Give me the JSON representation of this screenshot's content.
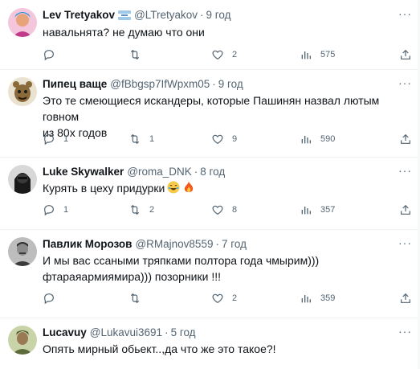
{
  "tweets": [
    {
      "name": "Lev Tretyakov",
      "handle": "@LTretyakov",
      "time": "9 год",
      "lines": [
        "навальнята? не думаю что они"
      ],
      "replies": "",
      "retweets": "",
      "likes": "2",
      "views": "575",
      "avatar_color": "#c23a8a"
    },
    {
      "name": "Пипец ваще",
      "handle": "@fBbgsp7IfWpxm05",
      "time": "9 год",
      "lines": [
        "Это те смеющиеся искандеры, которые Пашинян назвал лютым говном",
        "из 80х годов"
      ],
      "replies": "1",
      "retweets": "1",
      "likes": "9",
      "views": "590",
      "avatar_color": "#8a6a3a"
    },
    {
      "name": "Luke Skywalker",
      "handle": "@roma_DNK",
      "time": "8 год",
      "lines": [
        "Курять в цеху придурки"
      ],
      "replies": "1",
      "retweets": "2",
      "likes": "8",
      "views": "357",
      "avatar_color": "#2b2b2b"
    },
    {
      "name": "Павлик Морозов",
      "handle": "@RMajnov8559",
      "time": "7 год",
      "lines": [
        "И мы вас ссаными тряпками полтора года чмырим)))",
        "фтараяармиямира))) позорники !!!"
      ],
      "replies": "",
      "retweets": "",
      "likes": "2",
      "views": "359",
      "avatar_color": "#6b6b6b"
    },
    {
      "name": "Lucavuy",
      "handle": "@Lukavui3691",
      "time": "5 год",
      "lines": [
        "Опять мирный обьект..,да что же это такое?!"
      ],
      "replies": "",
      "retweets": "",
      "likes": "",
      "views": "",
      "avatar_color": "#7a8a4a"
    }
  ],
  "ui": {
    "more_label": "···",
    "dot": "·"
  },
  "icons": {
    "reply": "reply-icon",
    "retweet": "retweet-icon",
    "like": "heart-icon",
    "views": "views-bar-chart-icon",
    "share": "share-icon"
  }
}
